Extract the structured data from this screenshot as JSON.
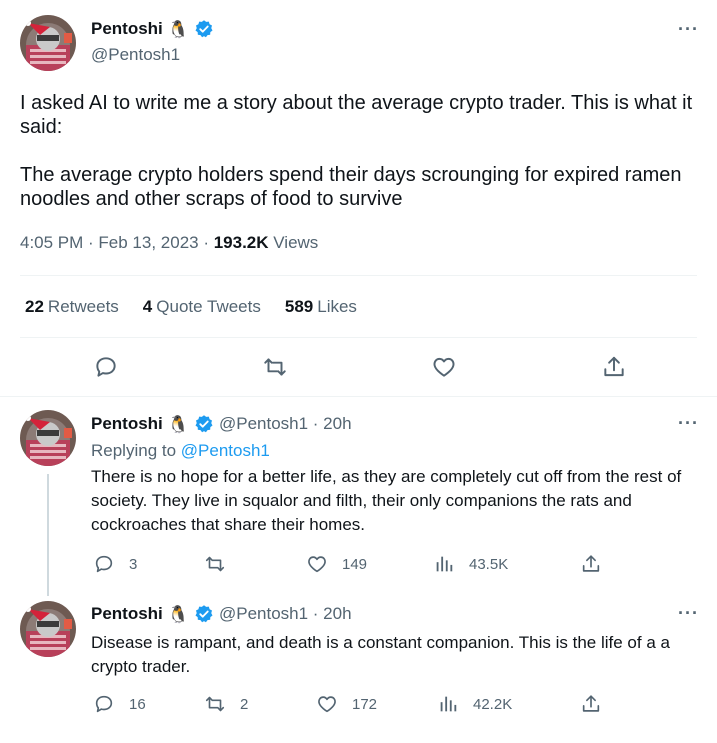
{
  "main_tweet": {
    "author_name": "Pentoshi",
    "author_handle": "@Pentosh1",
    "emoji": "🐧",
    "more_label": "···",
    "text_p1": "I asked AI to write me a story about the average crypto trader. This is what it said:",
    "text_p2": "The average crypto holders spend their days scrounging for expired ramen noodles and other scraps of food to survive",
    "time": "4:05 PM · Feb 13, 2023 · ",
    "views_count": "193.2K",
    "views_label": " Views",
    "retweets_count": "22",
    "retweets_label": "Retweets",
    "quotes_count": "4",
    "quotes_label": "Quote Tweets",
    "likes_count": "589",
    "likes_label": "Likes"
  },
  "replies": [
    {
      "author_name": "Pentoshi",
      "emoji": "🐧",
      "handle_time": "@Pentosh1 · 20h",
      "replying_prefix": "Replying to ",
      "replying_handle": "@Pentosh1",
      "text": "There is no hope for a better life, as they are completely cut off from the rest of society. They live in squalor and filth, their only companions the rats and cockroaches that share their homes.",
      "replies": "3",
      "retweets": "",
      "likes": "149",
      "views": "43.5K"
    },
    {
      "author_name": "Pentoshi",
      "emoji": "🐧",
      "handle_time": "@Pentosh1 · 20h",
      "text": "Disease is rampant, and death is a constant companion. This is the life of a a crypto trader.",
      "replies": "16",
      "retweets": "2",
      "likes": "172",
      "views": "42.2K"
    }
  ],
  "colors": {
    "verified": "#1d9bf0",
    "secondary_text": "#536471",
    "link": "#1d9bf0"
  }
}
